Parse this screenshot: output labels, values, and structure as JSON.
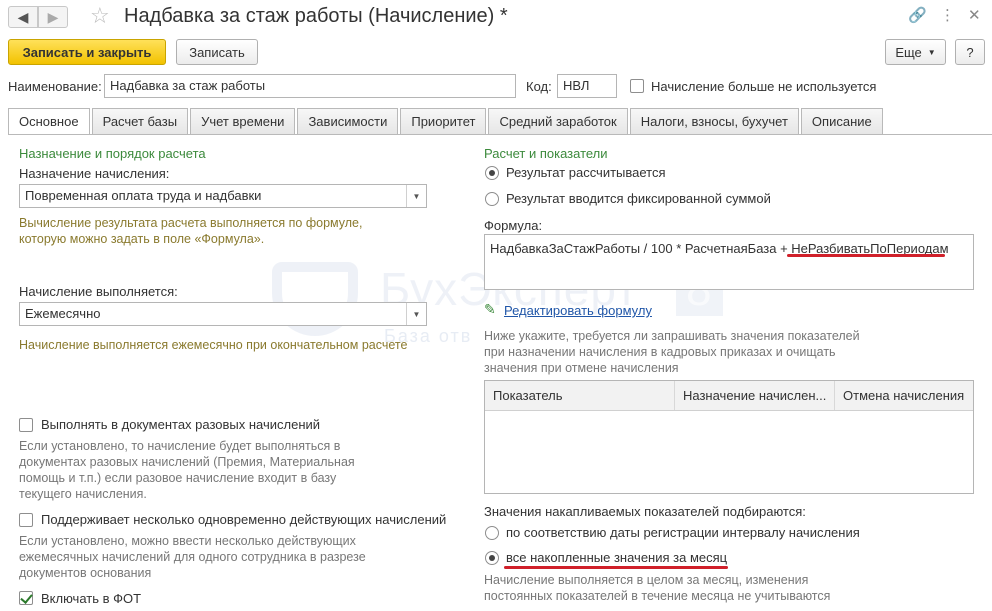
{
  "window": {
    "title": "Надбавка за стаж работы (Начисление) *",
    "icons": {
      "back": "arrow-left-icon",
      "forward": "arrow-right-icon",
      "favorite": "star-icon",
      "link": "link-icon",
      "menu": "more-vertical-icon",
      "close": "close-icon"
    }
  },
  "toolbar": {
    "save_close": "Записать и закрыть",
    "save": "Записать",
    "more": "Еще",
    "help": "?"
  },
  "header": {
    "name_label": "Наименование:",
    "name_value": "Надбавка за стаж работы",
    "code_label": "Код:",
    "code_value": "НВЛ",
    "unused_label": "Начисление больше не используется",
    "unused_checked": false
  },
  "tabs": [
    {
      "label": "Основное",
      "active": true
    },
    {
      "label": "Расчет базы",
      "active": false
    },
    {
      "label": "Учет времени",
      "active": false
    },
    {
      "label": "Зависимости",
      "active": false
    },
    {
      "label": "Приоритет",
      "active": false
    },
    {
      "label": "Средний заработок",
      "active": false
    },
    {
      "label": "Налоги, взносы, бухучет",
      "active": false
    },
    {
      "label": "Описание",
      "active": false
    }
  ],
  "left": {
    "section_title": "Назначение и порядок расчета",
    "purpose_label": "Назначение начисления:",
    "purpose_value": "Повременная оплата труда и надбавки",
    "purpose_hint_1": "Вычисление результата расчета выполняется по формуле,",
    "purpose_hint_2": "которую можно задать в поле «Формула».",
    "exec_label": "Начисление выполняется:",
    "exec_value": "Ежемесячно",
    "exec_hint": "Начисление выполняется ежемесячно при окончательном расчете",
    "one_time_label": "Выполнять в документах разовых начислений",
    "one_time_checked": false,
    "one_time_note": [
      "Если установлено, то начисление будет выполняться в",
      "документах разовых начислений (Премия, Материальная",
      "помощь и т.п.) если разовое начисление входит в базу",
      "текущего начисления."
    ],
    "multi_label": "Поддерживает несколько одновременно действующих начислений",
    "multi_checked": false,
    "multi_note": [
      "Если установлено, можно ввести несколько действующих",
      "ежемесячных начислений для одного сотрудника в разрезе",
      "документов основания"
    ],
    "fot_label": "Включать в ФОТ",
    "fot_checked": true
  },
  "right": {
    "section_title": "Расчет и показатели",
    "radio_calc": "Результат рассчитывается",
    "radio_fixed": "Результат вводится фиксированной суммой",
    "selected_result": "calc",
    "formula_label": "Формула:",
    "formula_main": "НадбавкаЗаСтажРаботы / 100 * РасчетнаяБаза + ",
    "formula_tail": "НеРазбиватьПоПериодам",
    "edit_formula": "Редактировать формулу",
    "indicators_note": [
      "Ниже укажите, требуется ли запрашивать значения показателей",
      "при назначении начисления в кадровых приказах и очищать",
      "значения при отмене начисления"
    ],
    "table_headers": [
      "Показатель",
      "Назначение начислен...",
      "Отмена начисления"
    ],
    "accum_label": "Значения накапливаемых показателей подбираются:",
    "accum_opt_1": "по соответствию даты регистрации интервалу начисления",
    "accum_opt_2": "все накопленные значения за месяц",
    "accum_selected": "opt2",
    "accum_note": [
      "Начисление выполняется в целом за месяц, изменения",
      "постоянных показателей в течение месяца не учитываются"
    ]
  },
  "watermark": {
    "brand": "БухЭксперт",
    "digit": "8",
    "sub": "База отв"
  },
  "colors": {
    "primary_button": "#f2c200",
    "section": "#3c8a3c",
    "hint": "#8a7a2e",
    "link": "#2056a8",
    "underline_mark": "#d0202a"
  }
}
